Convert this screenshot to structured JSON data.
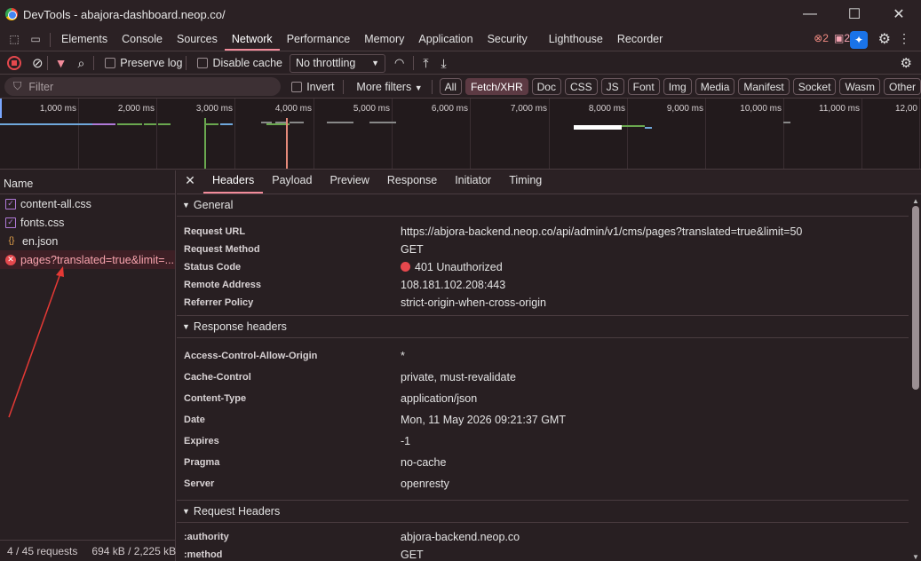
{
  "window": {
    "title": "DevTools - abajora-dashboard.neop.co/"
  },
  "panel_tabs": [
    "Elements",
    "Console",
    "Sources",
    "Network",
    "Performance",
    "Memory",
    "Application",
    "Security",
    "Lighthouse",
    "Recorder"
  ],
  "active_panel": "Network",
  "issues": {
    "errors": "2",
    "messages": "2"
  },
  "toolbar": {
    "preserve_log": "Preserve log",
    "disable_cache": "Disable cache",
    "throttling": "No throttling"
  },
  "filter": {
    "placeholder": "Filter",
    "invert": "Invert",
    "more_filters": "More filters"
  },
  "type_filters": [
    "All",
    "Fetch/XHR",
    "Doc",
    "CSS",
    "JS",
    "Font",
    "Img",
    "Media",
    "Manifest",
    "Socket",
    "Wasm",
    "Other"
  ],
  "active_type_filter": "Fetch/XHR",
  "timeline_ticks": [
    "1,000 ms",
    "2,000 ms",
    "3,000 ms",
    "4,000 ms",
    "5,000 ms",
    "6,000 ms",
    "7,000 ms",
    "8,000 ms",
    "9,000 ms",
    "10,000 ms",
    "11,000 ms",
    "12,00"
  ],
  "requests": {
    "header": "Name",
    "items": [
      {
        "name": "content-all.css",
        "type": "css",
        "error": false
      },
      {
        "name": "fonts.css",
        "type": "css",
        "error": false
      },
      {
        "name": "en.json",
        "type": "json",
        "error": false
      },
      {
        "name": "pages?translated=true&limit=...",
        "type": "xhr",
        "error": true
      }
    ]
  },
  "status_bar": {
    "requests": "4 / 45 requests",
    "transferred": "694 kB / 2,225 kB"
  },
  "detail_tabs": [
    "Headers",
    "Payload",
    "Preview",
    "Response",
    "Initiator",
    "Timing"
  ],
  "active_detail_tab": "Headers",
  "general": {
    "title": "General",
    "rows": [
      {
        "k": "Request URL",
        "v": "https://abjora-backend.neop.co/api/admin/v1/cms/pages?translated=true&limit=50"
      },
      {
        "k": "Request Method",
        "v": "GET"
      },
      {
        "k": "Status Code",
        "v": "401 Unauthorized"
      },
      {
        "k": "Remote Address",
        "v": "108.181.102.208:443"
      },
      {
        "k": "Referrer Policy",
        "v": "strict-origin-when-cross-origin"
      }
    ]
  },
  "response_headers": {
    "title": "Response headers",
    "rows": [
      {
        "k": "Access-Control-Allow-Origin",
        "v": "*"
      },
      {
        "k": "Cache-Control",
        "v": "private, must-revalidate"
      },
      {
        "k": "Content-Type",
        "v": "application/json"
      },
      {
        "k": "Date",
        "v": "Mon, 11 May 2026 09:21:37 GMT"
      },
      {
        "k": "Expires",
        "v": "-1"
      },
      {
        "k": "Pragma",
        "v": "no-cache"
      },
      {
        "k": "Server",
        "v": "openresty"
      }
    ]
  },
  "request_headers": {
    "title": "Request Headers",
    "rows": [
      {
        "k": ":authority",
        "v": "abjora-backend.neop.co"
      },
      {
        "k": ":method",
        "v": "GET"
      }
    ]
  },
  "colors": {
    "accent": "#f28b9a",
    "error": "#e5484d",
    "annotation_arrow": "#e53935"
  }
}
